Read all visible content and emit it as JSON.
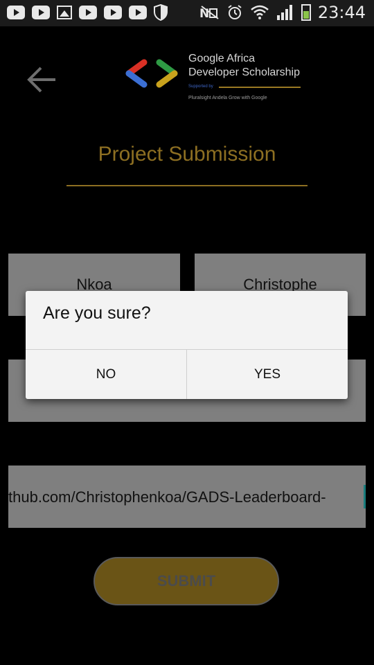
{
  "status_bar": {
    "time": "23:44",
    "left_icons": [
      "youtube-icon",
      "youtube-icon",
      "gallery-icon",
      "youtube-icon",
      "youtube-icon",
      "youtube-icon",
      "shield-icon"
    ],
    "right_icons": [
      "nfc-off-icon",
      "alarm-icon",
      "wifi-icon",
      "signal-icon",
      "battery-icon"
    ],
    "battery_level": 0.55
  },
  "header": {
    "back_icon": "arrow-left-icon",
    "logo": {
      "line1": "Google Africa",
      "line2": "Developer Scholarship",
      "supported": "Supported by",
      "partners": "Pluralsight    Andela   Grow with Google"
    }
  },
  "page_title": "Project Submission",
  "form": {
    "first_name": "Nkoa",
    "last_name": "Christophe",
    "email": "",
    "project_link": "thub.com/Christophenkoa/GADS-Leaderboard-"
  },
  "submit_label": "SUBMIT",
  "dialog": {
    "title": "Are you sure?",
    "no_label": "NO",
    "yes_label": "YES"
  },
  "colors": {
    "accent_gold": "#8d6f22",
    "dialog_bg": "#f3f3f3",
    "field_bg_dimmed": "#7f7f7f"
  }
}
